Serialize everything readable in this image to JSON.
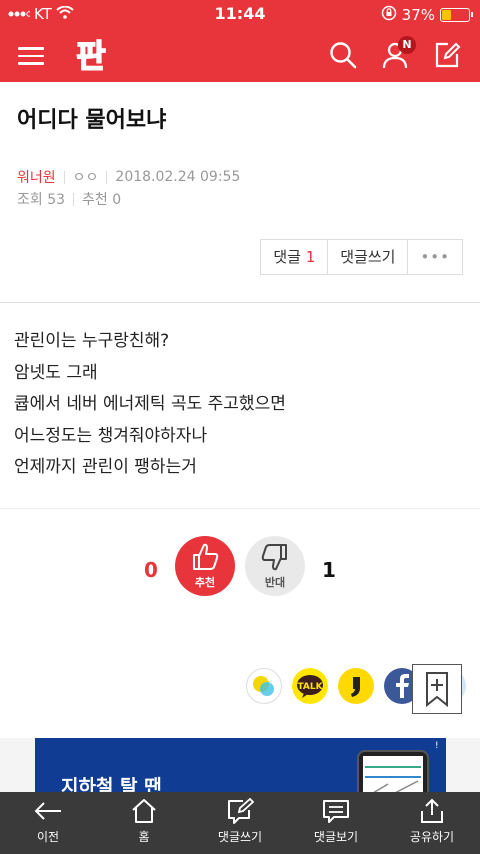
{
  "status_bar": {
    "carrier": "KT",
    "time": "11:44",
    "battery_pct": "37%",
    "battery_level": 0.37
  },
  "header": {
    "logo_text": "판",
    "notification_badge": "N"
  },
  "post": {
    "title": "어디다 물어보냐",
    "author": "워너원",
    "author_sub": "ㅇㅇ",
    "datetime": "2018.02.24 09:55",
    "views": "조회 53",
    "recommends": "추천 0"
  },
  "actions": {
    "comment_label": "댓글",
    "comment_count": "1",
    "write_comment": "댓글쓰기",
    "more": "•••"
  },
  "content_lines": [
    "관린이는 누구랑친해?",
    "암넷도 그래",
    "큡에서 네버 에너제틱 곡도 주고했으면",
    "어느정도는 챙겨줘야하자나",
    "언제까지 관린이 팽하는거"
  ],
  "vote": {
    "up_count": "0",
    "up_label": "추천",
    "down_label": "반대",
    "down_count": "1"
  },
  "share": {
    "kakaotalk_label": "TALK"
  },
  "ad": {
    "text": "지하철 탈 땐"
  },
  "bottom_nav": [
    {
      "label": "이전",
      "icon": "back-arrow-icon"
    },
    {
      "label": "홈",
      "icon": "home-icon"
    },
    {
      "label": "댓글쓰기",
      "icon": "write-comment-icon"
    },
    {
      "label": "댓글보기",
      "icon": "view-comments-icon"
    },
    {
      "label": "공유하기",
      "icon": "share-icon"
    }
  ],
  "colors": {
    "brand": "#e8353b",
    "bottom_bar": "#3a3a3a",
    "ad_bg": "#103d93"
  }
}
